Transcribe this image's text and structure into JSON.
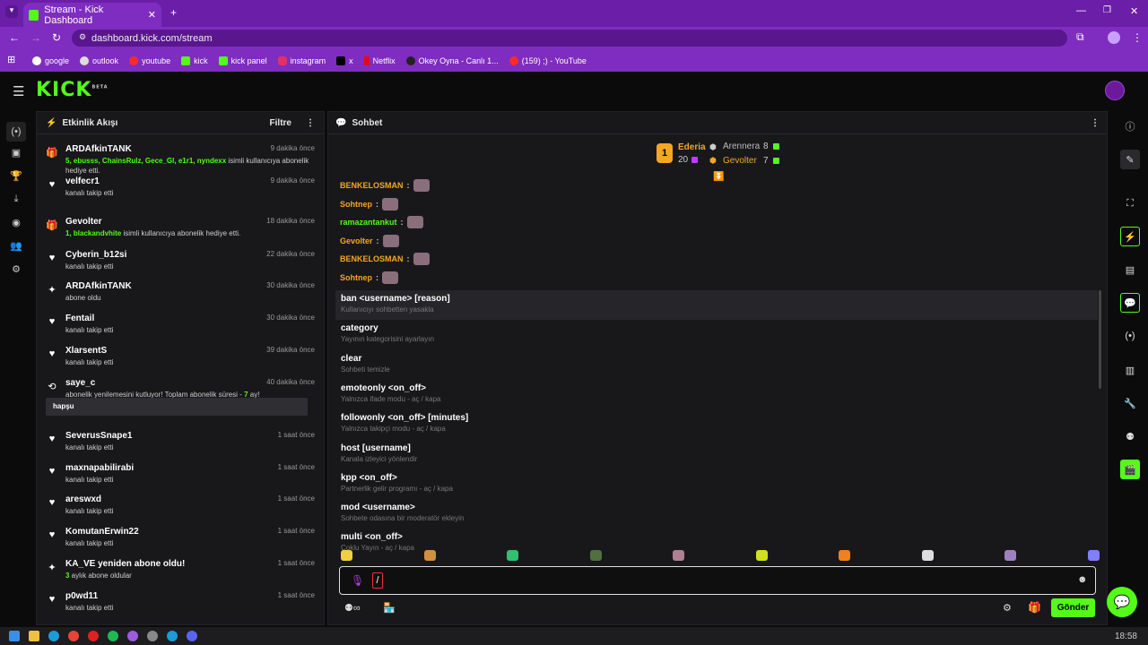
{
  "browser": {
    "tab_title": "Stream - Kick Dashboard",
    "url": "dashboard.kick.com/stream",
    "bookmarks": [
      "google",
      "outlook",
      "youtube",
      "kick",
      "kick panel",
      "instagram",
      "x",
      "Netflix",
      "Okey Oyna - Canlı 1...",
      "(159) ;) - YouTube"
    ]
  },
  "brand": {
    "logo": "KICK",
    "beta": "BETA",
    "accent": "#53fc18"
  },
  "activity": {
    "title": "Etkinlik Akışı",
    "filter": "Filtre",
    "events": [
      {
        "icon": "gift-icon",
        "glyph": "🎁",
        "name": "ARDAfkinTANK",
        "time": "9 dakika önce",
        "hl": "5, ebusss, ChainsRulz, Gece_Gl, e1r1, nyndexx",
        "desc": " isimli kullanıcıya abonelik hediye etti."
      },
      {
        "icon": "heart-icon",
        "glyph": "♥",
        "name": "velfecr1",
        "time": "9 dakika önce",
        "desc": "kanalı takip etti"
      },
      {
        "icon": "gift-icon",
        "glyph": "🎁",
        "name": "Gevolter",
        "time": "18 dakika önce",
        "hl": "1, blackandvhite",
        "desc": " isimli kullanıcıya abonelik hediye etti."
      },
      {
        "icon": "heart-icon",
        "glyph": "♥",
        "name": "Cyberin_b12si",
        "time": "22 dakika önce",
        "desc": "kanalı takip etti"
      },
      {
        "icon": "sparkle-icon",
        "glyph": "✦",
        "name": "ARDAfkinTANK",
        "time": "30 dakika önce",
        "desc": "abone oldu"
      },
      {
        "icon": "heart-icon",
        "glyph": "♥",
        "name": "Fentail",
        "time": "30 dakika önce",
        "desc": "kanalı takip etti"
      },
      {
        "icon": "heart-icon",
        "glyph": "♥",
        "name": "XlarsentS",
        "time": "39 dakika önce",
        "desc": "kanalı takip etti"
      },
      {
        "icon": "resub-icon",
        "glyph": "⟲",
        "name": "saye_c",
        "time": "40 dakika önce",
        "desc": "abonelik yenilemesini kutluyor! Toplam abonelik süresi - ",
        "hl2": "7",
        "desc2": " ay!",
        "note": "hapşu"
      },
      {
        "icon": "heart-icon",
        "glyph": "♥",
        "name": "SeverusSnape1",
        "time": "1 saat önce",
        "desc": "kanalı takip etti"
      },
      {
        "icon": "heart-icon",
        "glyph": "♥",
        "name": "maxnapabilirabi",
        "time": "1 saat önce",
        "desc": "kanalı takip etti"
      },
      {
        "icon": "heart-icon",
        "glyph": "♥",
        "name": "areswxd",
        "time": "1 saat önce",
        "desc": "kanalı takip etti"
      },
      {
        "icon": "heart-icon",
        "glyph": "♥",
        "name": "KomutanErwin22",
        "time": "1 saat önce",
        "desc": "kanalı takip etti"
      },
      {
        "icon": "sparkle-icon",
        "glyph": "✦",
        "name": "KA_VE yeniden abone oldu!",
        "time": "1 saat önce",
        "hl": "3",
        "desc": " aylık abone oldular"
      },
      {
        "icon": "heart-icon",
        "glyph": "♥",
        "name": "p0wd11",
        "time": "1 saat önce",
        "desc": "kanalı takip etti"
      }
    ]
  },
  "chat": {
    "title": "Sohbet",
    "leaderboard": {
      "first": {
        "rank": "1",
        "name": "Ederia",
        "count": "20"
      },
      "second": {
        "name": "Arennera",
        "count": "8"
      },
      "third": {
        "name": "Gevolter",
        "count": "7"
      }
    },
    "messages": [
      {
        "user": "BENKELOSMAN",
        "color": "#f5a623"
      },
      {
        "user": "Sohtnep",
        "color": "#f5a623"
      },
      {
        "user": "ramazantankut",
        "color": "#53fc18"
      },
      {
        "user": "Gevolter",
        "color": "#f5a623"
      },
      {
        "user": "BENKELOSMAN",
        "color": "#f5a623"
      },
      {
        "user": "Sohtnep",
        "color": "#f5a623"
      }
    ],
    "commands": [
      {
        "name": "ban <username> [reason]",
        "desc": "Kullanıcıyı sohbetten yasakla"
      },
      {
        "name": "category",
        "desc": "Yayının kategorisini ayarlayın"
      },
      {
        "name": "clear",
        "desc": "Sohbeti temizle"
      },
      {
        "name": "emoteonly <on_off>",
        "desc": "Yalnızca ifade modu - aç / kapa"
      },
      {
        "name": "followonly <on_off> [minutes]",
        "desc": "Yalnızca takipçi modu - aç / kapa"
      },
      {
        "name": "host [username]",
        "desc": "Kanala izleyici yönlendir"
      },
      {
        "name": "kpp <on_off>",
        "desc": "Partnerlik gelir programı - aç / kapa"
      },
      {
        "name": "mod <username>",
        "desc": "Sohbete odasına bir moderatör ekleyin"
      },
      {
        "name": "multi <on_off>",
        "desc": "Çoklu Yayın - aç / kapa"
      }
    ],
    "input_value": "/",
    "send_label": "Gönder"
  },
  "taskbar": {
    "time": "18:58"
  }
}
